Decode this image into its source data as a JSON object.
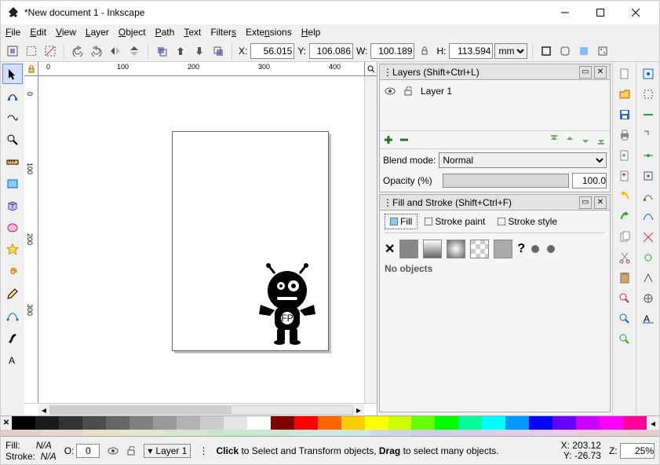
{
  "window": {
    "title": "*New document 1 - Inkscape",
    "app": "Inkscape"
  },
  "menu": {
    "items": [
      "File",
      "Edit",
      "View",
      "Layer",
      "Object",
      "Path",
      "Text",
      "Filters",
      "Extensions",
      "Help"
    ]
  },
  "toolbar": {
    "X": "56.015",
    "Y": "106.086",
    "W": "100.189",
    "H": "113.594",
    "X_label": "X:",
    "Y_label": "Y:",
    "W_label": "W:",
    "H_label": "H:",
    "units": "mm"
  },
  "ruler_h": {
    "t0": "0",
    "t100": "100",
    "t200": "200",
    "t300": "300",
    "t400": "400"
  },
  "ruler_v": {
    "t0": "0",
    "t100": "100",
    "t200": "200",
    "t300": "300"
  },
  "layers_panel": {
    "title": "Layers (Shift+Ctrl+L)",
    "items": [
      {
        "name": "Layer 1",
        "visible": true,
        "locked": false
      }
    ],
    "blend_label": "Blend mode:",
    "blend_value": "Normal",
    "opacity_label": "Opacity (%)",
    "opacity_value": "100.0"
  },
  "fill_panel": {
    "title": "Fill and Stroke (Shift+Ctrl+F)",
    "tabs": {
      "fill": "Fill",
      "stroke_paint": "Stroke paint",
      "stroke_style": "Stroke style"
    },
    "message": "No objects"
  },
  "palette": {
    "colors": [
      "#000000",
      "#1a1a1a",
      "#333333",
      "#4d4d4d",
      "#666666",
      "#808080",
      "#999999",
      "#b3b3b3",
      "#cccccc",
      "#e6e6e6",
      "#ffffff",
      "#800000",
      "#ff0000",
      "#ff6600",
      "#ffcc00",
      "#ffff00",
      "#ccff00",
      "#66ff00",
      "#00ff00",
      "#00ff99",
      "#00ffff",
      "#0099ff",
      "#0000ff",
      "#6600ff",
      "#cc00ff",
      "#ff00ff",
      "#ff0099"
    ],
    "desat": [
      "#e6cccc",
      "#e6d6cc",
      "#e6e0cc",
      "#e6e6cc",
      "#d6e6cc",
      "#cce6cc",
      "#cce6d6",
      "#cce6e0",
      "#cce6e6",
      "#ccd6e6",
      "#cccce6",
      "#d6cce6",
      "#e0cce6",
      "#e6cce6",
      "#e6ccd6",
      "#e6cccc"
    ]
  },
  "status": {
    "fill_label": "Fill:",
    "fill_value": "N/A",
    "stroke_label": "Stroke:",
    "stroke_value": "N/A",
    "O_label": "O:",
    "O_value": "0",
    "layer": "Layer 1",
    "msg_pre": "Click",
    "msg_mid": " to Select and Transform objects, ",
    "msg_drag": "Drag",
    "msg_post": " to select many objects.",
    "X_label": "X:",
    "X": "203.12",
    "Y_label": "Y:",
    "Y": "-26.73",
    "Z_label": "Z:",
    "zoom": "25%"
  }
}
